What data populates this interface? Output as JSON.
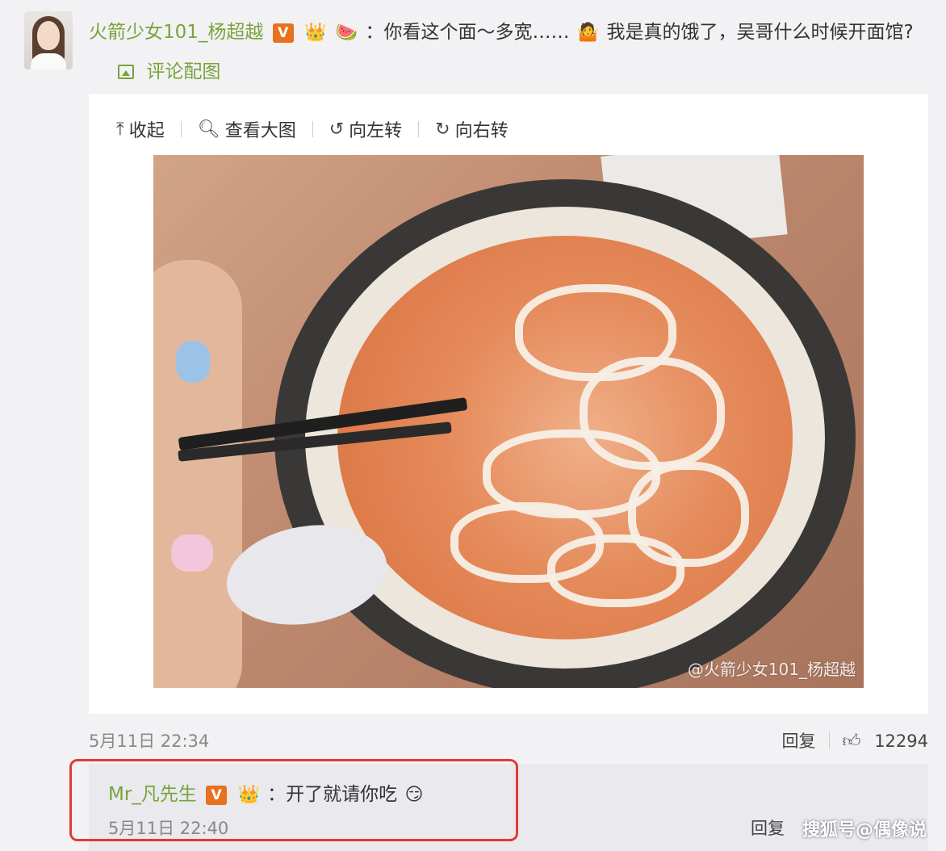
{
  "post": {
    "username": "火箭少女101_杨超越",
    "text_part1": "：你看这个面～多宽……",
    "text_part2": "我是真的饿了，吴哥什么时候开面馆?",
    "comment_pic_label": "评论配图",
    "v_badge": "V",
    "time": "5月11日 22:34",
    "reply_label": "回复",
    "like_count": "12294"
  },
  "toolbar": {
    "collapse": "收起",
    "view_large": "查看大图",
    "rotate_left": "向左转",
    "rotate_right": "向右转"
  },
  "image": {
    "watermark": "@火箭少女101_杨超越"
  },
  "reply": {
    "username": "Mr_凡先生",
    "v_badge": "V",
    "text": "：开了就请你吃",
    "time": "5月11日 22:40",
    "reply_label": "回复"
  },
  "corner_mark": "搜狐号@偶像说",
  "colors": {
    "accent": "#7aa33a",
    "badge": "#e8711f",
    "highlight": "#e53935"
  }
}
